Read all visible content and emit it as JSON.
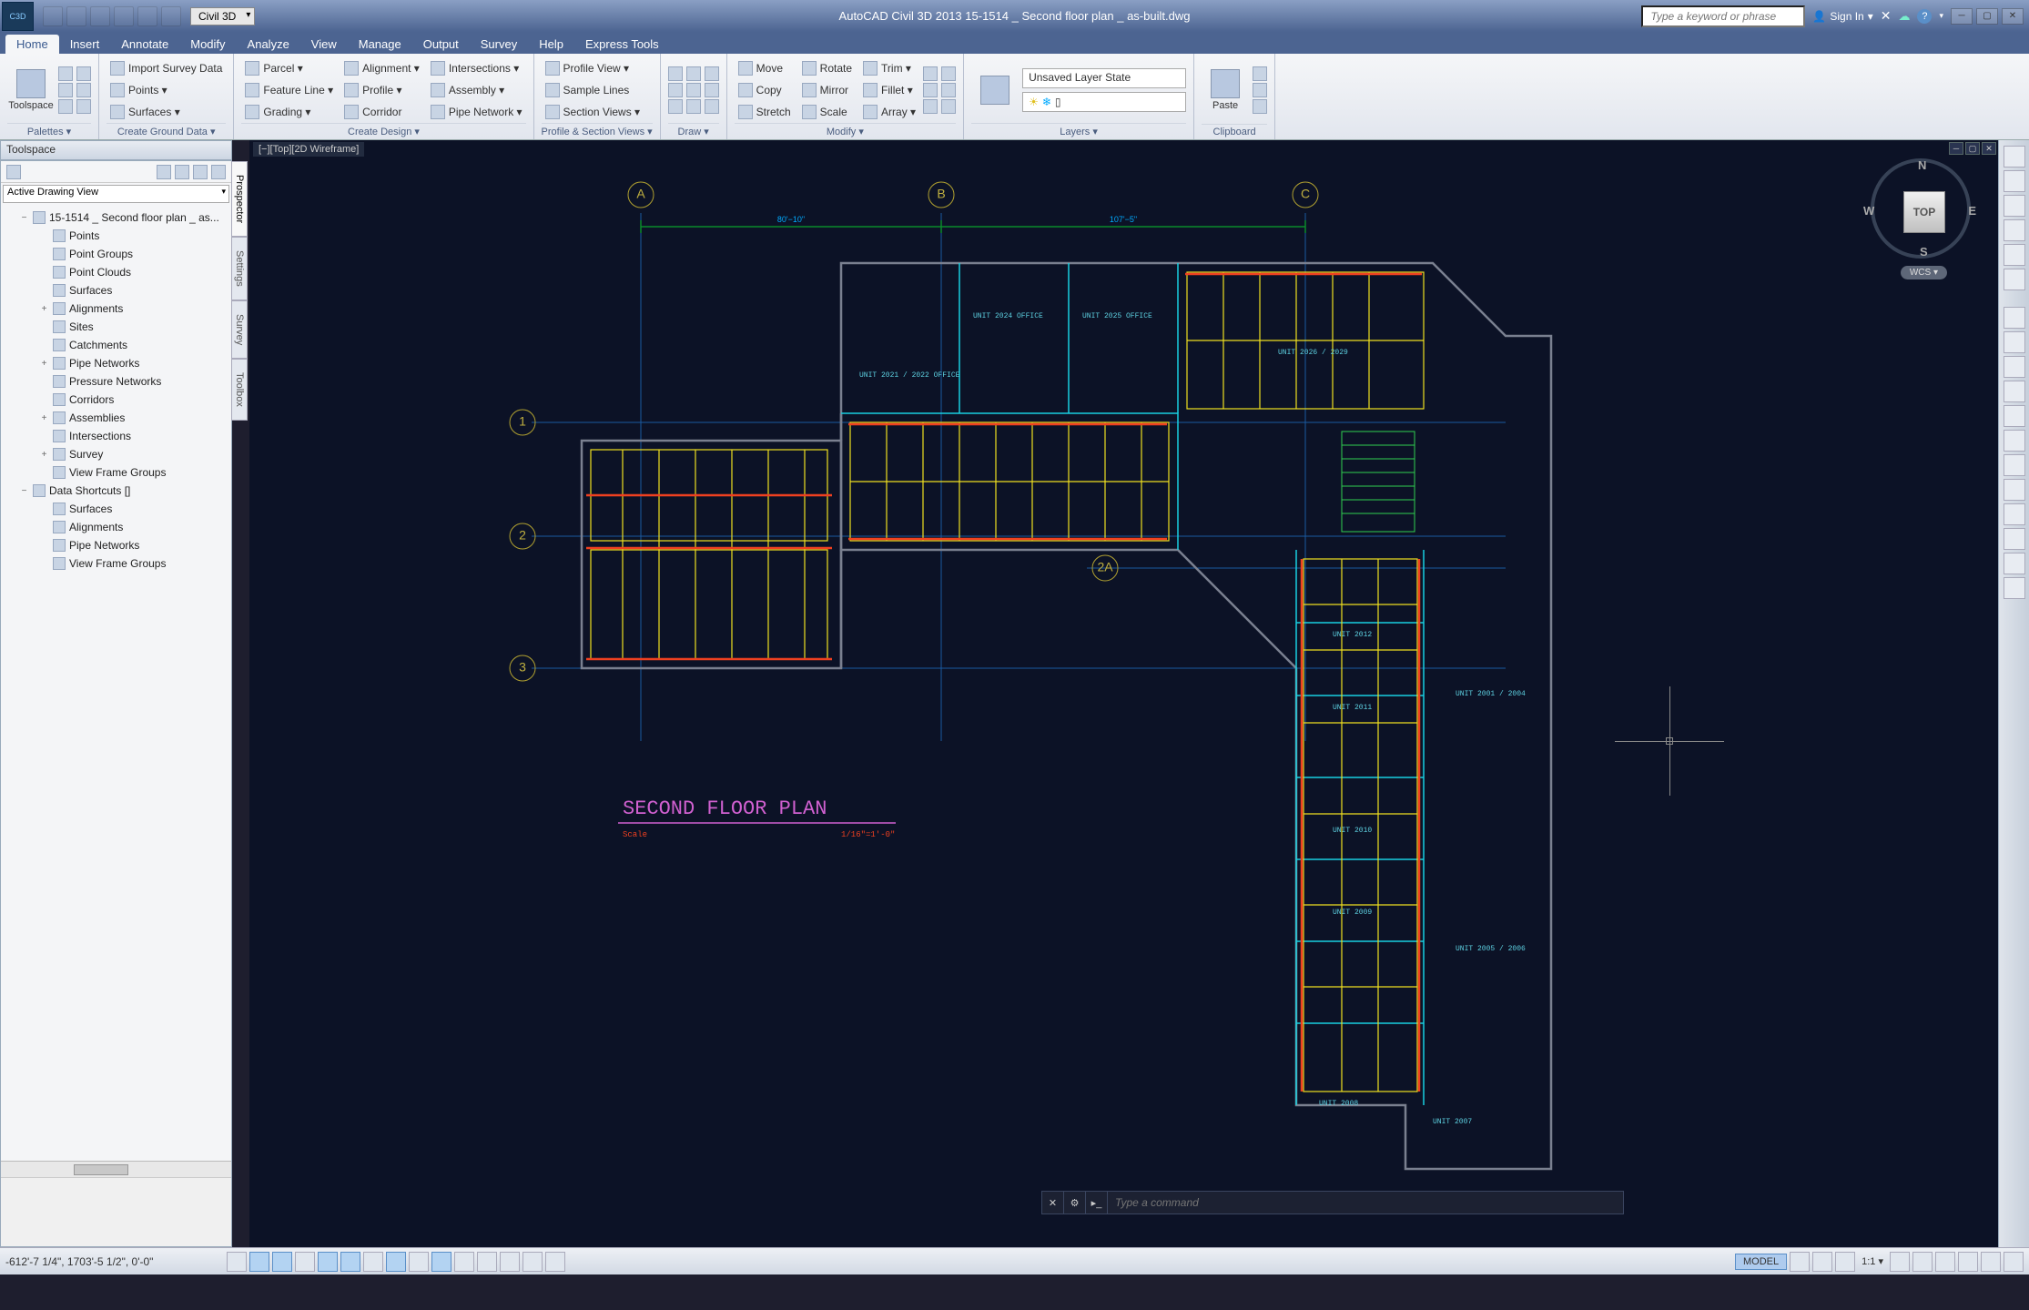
{
  "app": {
    "icon_label": "C3D",
    "workspace": "Civil 3D",
    "title": "AutoCAD Civil 3D 2013    15-1514 _ Second floor plan _ as-built.dwg",
    "search_placeholder": "Type a keyword or phrase",
    "sign_in": "Sign In"
  },
  "tabs": [
    "Home",
    "Insert",
    "Annotate",
    "Modify",
    "Analyze",
    "View",
    "Manage",
    "Output",
    "Survey",
    "Help",
    "Express Tools"
  ],
  "active_tab": "Home",
  "ribbon": {
    "palettes": {
      "big": "Toolspace",
      "label": "Palettes  ▾"
    },
    "ground": {
      "items": [
        "Import Survey Data",
        "Points  ▾",
        "Surfaces  ▾"
      ],
      "label": "Create Ground Data  ▾"
    },
    "design": {
      "col1": [
        "Parcel  ▾",
        "Feature Line  ▾",
        "Grading  ▾"
      ],
      "col2": [
        "Alignment  ▾",
        "Profile  ▾",
        "Corridor"
      ],
      "col3": [
        "Intersections  ▾",
        "Assembly  ▾",
        "Pipe Network  ▾"
      ],
      "label": "Create Design  ▾"
    },
    "profile": {
      "items": [
        "Profile View  ▾",
        "Sample Lines",
        "Section Views  ▾"
      ],
      "label": "Profile & Section Views  ▾"
    },
    "draw": {
      "label": "Draw  ▾"
    },
    "modify": {
      "col1": [
        "Move",
        "Copy",
        "Stretch"
      ],
      "col2": [
        "Rotate",
        "Mirror",
        "Scale"
      ],
      "col3": [
        "Trim  ▾",
        "Fillet  ▾",
        "Array  ▾"
      ],
      "label": "Modify  ▾"
    },
    "layers": {
      "state": "Unsaved Layer State",
      "label": "Layers  ▾"
    },
    "clipboard": {
      "big": "Paste",
      "label": "Clipboard"
    }
  },
  "toolspace": {
    "title": "Toolspace",
    "view_combo": "Active Drawing View",
    "side_tabs": [
      "Prospector",
      "Settings",
      "Survey",
      "Toolbox"
    ],
    "tree": [
      {
        "ind": 0,
        "exp": "−",
        "label": "15-1514 _ Second floor plan _ as..."
      },
      {
        "ind": 1,
        "exp": "",
        "label": "Points"
      },
      {
        "ind": 1,
        "exp": "",
        "label": "Point Groups"
      },
      {
        "ind": 1,
        "exp": "",
        "label": "Point Clouds"
      },
      {
        "ind": 1,
        "exp": "",
        "label": "Surfaces"
      },
      {
        "ind": 1,
        "exp": "+",
        "label": "Alignments"
      },
      {
        "ind": 1,
        "exp": "",
        "label": "Sites"
      },
      {
        "ind": 1,
        "exp": "",
        "label": "Catchments"
      },
      {
        "ind": 1,
        "exp": "+",
        "label": "Pipe Networks"
      },
      {
        "ind": 1,
        "exp": "",
        "label": "Pressure Networks"
      },
      {
        "ind": 1,
        "exp": "",
        "label": "Corridors"
      },
      {
        "ind": 1,
        "exp": "+",
        "label": "Assemblies"
      },
      {
        "ind": 1,
        "exp": "",
        "label": "Intersections"
      },
      {
        "ind": 1,
        "exp": "+",
        "label": "Survey"
      },
      {
        "ind": 1,
        "exp": "",
        "label": "View Frame Groups"
      },
      {
        "ind": 0,
        "exp": "−",
        "label": "Data Shortcuts []"
      },
      {
        "ind": 1,
        "exp": "",
        "label": "Surfaces"
      },
      {
        "ind": 1,
        "exp": "",
        "label": "Alignments"
      },
      {
        "ind": 1,
        "exp": "",
        "label": "Pipe Networks"
      },
      {
        "ind": 1,
        "exp": "",
        "label": "View Frame Groups"
      }
    ]
  },
  "drawing": {
    "view_label": "[−][Top][2D Wireframe]",
    "viewcube": {
      "face": "TOP",
      "n": "N",
      "s": "S",
      "e": "E",
      "w": "W",
      "wcs": "WCS ▾"
    },
    "grid": {
      "cols": [
        "A",
        "B",
        "C"
      ],
      "rows": [
        "1",
        "2",
        "2A",
        "3"
      ],
      "dim1": "80'−10\"",
      "dim2": "107'−5\""
    },
    "rooms": [
      "UNIT 2024 OFFICE",
      "UNIT 2025 OFFICE",
      "UNIT 2021 / 2022 OFFICE",
      "UNIT 2026 / 2029",
      "UNIT 2012",
      "UNIT 2011",
      "UNIT 2010",
      "UNIT 2009",
      "UNIT 2008",
      "UNIT 2007",
      "UNIT 2005 / 2006",
      "UNIT 2001 / 2004"
    ],
    "title": "SECOND FLOOR PLAN",
    "scale_label": "Scale",
    "scale_val": "1/16\"=1'-0\""
  },
  "cmdline": {
    "placeholder": "Type a command"
  },
  "status": {
    "coords": "-612'-7 1/4\", 1703'-5 1/2\", 0'-0\"",
    "model": "MODEL",
    "scale": "1:1 ▾"
  }
}
